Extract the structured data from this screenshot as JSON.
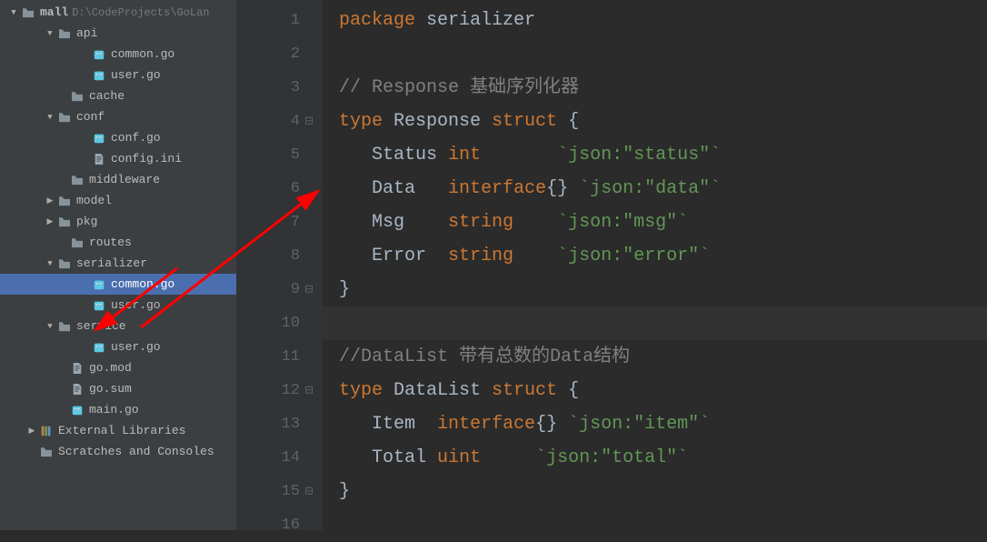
{
  "project": {
    "name": "mall",
    "path": "D:\\CodeProjects\\GoLan"
  },
  "tree": [
    {
      "label": "mall",
      "icon": "folder",
      "indent": "indent-0",
      "expand": "down",
      "bold": true,
      "suffix": "D:\\CodeProjects\\GoLan"
    },
    {
      "label": "api",
      "icon": "folder",
      "indent": "indent-1",
      "expand": "down"
    },
    {
      "label": "common.go",
      "icon": "go",
      "indent": "indent-3"
    },
    {
      "label": "user.go",
      "icon": "go",
      "indent": "indent-3"
    },
    {
      "label": "cache",
      "icon": "folder",
      "indent": "indent-2"
    },
    {
      "label": "conf",
      "icon": "folder",
      "indent": "indent-1",
      "expand": "down"
    },
    {
      "label": "conf.go",
      "icon": "go",
      "indent": "indent-3"
    },
    {
      "label": "config.ini",
      "icon": "text",
      "indent": "indent-3"
    },
    {
      "label": "middleware",
      "icon": "folder",
      "indent": "indent-2"
    },
    {
      "label": "model",
      "icon": "folder",
      "indent": "indent-1",
      "expand": "right"
    },
    {
      "label": "pkg",
      "icon": "folder",
      "indent": "indent-1",
      "expand": "right"
    },
    {
      "label": "routes",
      "icon": "folder",
      "indent": "indent-2"
    },
    {
      "label": "serializer",
      "icon": "folder",
      "indent": "indent-1",
      "expand": "down"
    },
    {
      "label": "common.go",
      "icon": "go",
      "indent": "indent-3",
      "selected": true
    },
    {
      "label": "user.go",
      "icon": "go",
      "indent": "indent-3"
    },
    {
      "label": "service",
      "icon": "folder",
      "indent": "indent-1",
      "expand": "down"
    },
    {
      "label": "user.go",
      "icon": "go",
      "indent": "indent-3"
    },
    {
      "label": "go.mod",
      "icon": "text",
      "indent": "indent-2"
    },
    {
      "label": "go.sum",
      "icon": "text",
      "indent": "indent-2"
    },
    {
      "label": "main.go",
      "icon": "go",
      "indent": "indent-2"
    },
    {
      "label": "External Libraries",
      "icon": "lib",
      "indent": "indent-lib",
      "expand": "right"
    },
    {
      "label": "Scratches and Consoles",
      "icon": "folder",
      "indent": "indent-lib",
      "cutoff": true
    }
  ],
  "code": {
    "lines": [
      {
        "n": "1",
        "tokens": [
          {
            "t": "package ",
            "c": "kw"
          },
          {
            "t": "serializer",
            "c": "plain"
          }
        ]
      },
      {
        "n": "2",
        "tokens": []
      },
      {
        "n": "3",
        "tokens": [
          {
            "t": "// Response 基础序列化器",
            "c": "comment"
          }
        ]
      },
      {
        "n": "4",
        "fold": "open-down",
        "tokens": [
          {
            "t": "type ",
            "c": "kw"
          },
          {
            "t": "Response ",
            "c": "typename"
          },
          {
            "t": "struct ",
            "c": "kw"
          },
          {
            "t": "{",
            "c": "punct"
          }
        ]
      },
      {
        "n": "5",
        "tokens": [
          {
            "t": "   Status ",
            "c": "plain"
          },
          {
            "t": "int",
            "c": "builtin"
          },
          {
            "t": "       ",
            "c": "plain"
          },
          {
            "t": "`json:\"status\"`",
            "c": "tag"
          }
        ]
      },
      {
        "n": "6",
        "tokens": [
          {
            "t": "   Data   ",
            "c": "plain"
          },
          {
            "t": "interface",
            "c": "kw"
          },
          {
            "t": "{} ",
            "c": "punct"
          },
          {
            "t": "`json:\"data\"`",
            "c": "tag"
          }
        ]
      },
      {
        "n": "7",
        "tokens": [
          {
            "t": "   Msg    ",
            "c": "plain"
          },
          {
            "t": "string",
            "c": "kw"
          },
          {
            "t": "    ",
            "c": "plain"
          },
          {
            "t": "`json:\"msg\"`",
            "c": "tag"
          }
        ]
      },
      {
        "n": "8",
        "tokens": [
          {
            "t": "   Error  ",
            "c": "plain"
          },
          {
            "t": "string",
            "c": "kw"
          },
          {
            "t": "    ",
            "c": "plain"
          },
          {
            "t": "`json:\"error\"`",
            "c": "tag"
          }
        ]
      },
      {
        "n": "9",
        "fold": "open-up",
        "tokens": [
          {
            "t": "}",
            "c": "punct"
          }
        ]
      },
      {
        "n": "10",
        "highlighted": true,
        "tokens": []
      },
      {
        "n": "11",
        "tokens": [
          {
            "t": "//DataList 带有总数的Data结构",
            "c": "comment"
          }
        ]
      },
      {
        "n": "12",
        "fold": "open-down",
        "tokens": [
          {
            "t": "type ",
            "c": "kw"
          },
          {
            "t": "DataList ",
            "c": "typename"
          },
          {
            "t": "struct ",
            "c": "kw"
          },
          {
            "t": "{",
            "c": "punct"
          }
        ]
      },
      {
        "n": "13",
        "tokens": [
          {
            "t": "   Item  ",
            "c": "plain"
          },
          {
            "t": "interface",
            "c": "kw"
          },
          {
            "t": "{} ",
            "c": "punct"
          },
          {
            "t": "`json:\"item\"`",
            "c": "tag"
          }
        ]
      },
      {
        "n": "14",
        "tokens": [
          {
            "t": "   Total ",
            "c": "plain"
          },
          {
            "t": "uint",
            "c": "builtin"
          },
          {
            "t": "     ",
            "c": "plain"
          },
          {
            "t": "`json:\"total\"`",
            "c": "tag"
          }
        ]
      },
      {
        "n": "15",
        "fold": "open-up",
        "tokens": [
          {
            "t": "}",
            "c": "punct"
          }
        ]
      },
      {
        "n": "16",
        "tokens": []
      }
    ]
  }
}
